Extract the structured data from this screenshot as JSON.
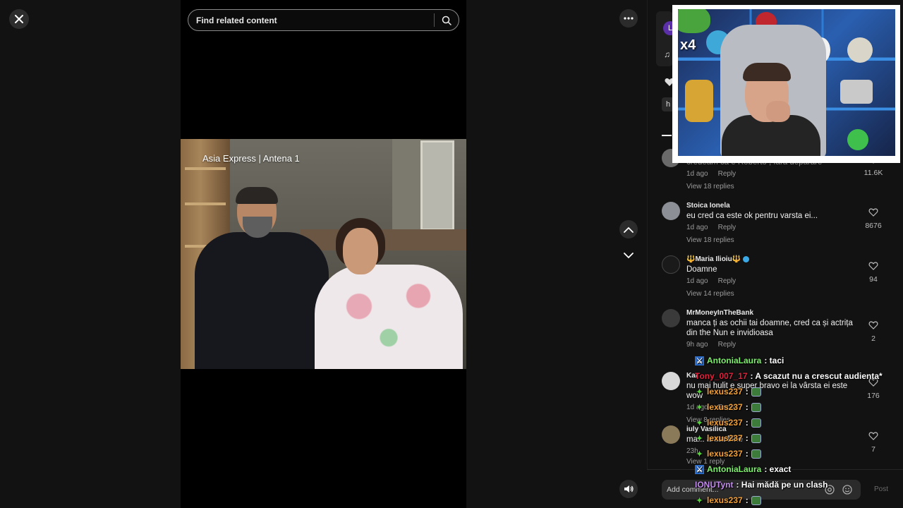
{
  "search": {
    "placeholder": "Find related content"
  },
  "video": {
    "watermark": "Asia Express | Antena 1"
  },
  "panel": {
    "avatar_letter": "L",
    "tag_letter": "h"
  },
  "comments": [
    {
      "user": "",
      "text": "credeam ca e Roberto , fara deparare",
      "time": "1d ago",
      "reply": "Reply",
      "view_replies": "View 18 replies",
      "likes": "11.6K"
    },
    {
      "user": "Stoica Ionela",
      "text": "eu cred ca este ok pentru varsta ei...",
      "time": "1d ago",
      "reply": "Reply",
      "view_replies": "View 18 replies",
      "likes": "8676"
    },
    {
      "user": "🔱Maria Ilioiu🔱",
      "text": "Doamne",
      "time": "1d ago",
      "reply": "Reply",
      "view_replies": "View 14 replies",
      "likes": "94"
    },
    {
      "user": "MrMoneyInTheBank",
      "text": "manca ți as ochii tai doamne, cred ca și actrița din the Nun e invidioasa",
      "time": "9h ago",
      "reply": "Reply",
      "view_replies": "",
      "likes": "2"
    },
    {
      "user": "Kar",
      "text": "nu mai hulit e super bravo ei la vârsta ei este wow",
      "time": "1d ago",
      "reply": "Reply",
      "view_replies": "View 8 replies",
      "likes": "176"
    },
    {
      "user": "iuly Vasilica",
      "text": "ma... arata bine",
      "time": "23h",
      "reply": "",
      "view_replies": "View 1 reply",
      "likes": "7"
    }
  ],
  "comment_bar": {
    "placeholder": "Add comment...",
    "post_label": "Post"
  },
  "webcam": {
    "multiplier": "x4"
  },
  "chat": [
    {
      "user": "AntoniaLaura",
      "color": "#7cf06a",
      "badge": "mod",
      "msg": ": taci"
    },
    {
      "user": "Tony_007_17",
      "color": "#e0223c",
      "badge": "none",
      "msg": ": A scazut nu a crescut audienta*"
    },
    {
      "user": "lexus237",
      "color": "#f0a03a",
      "badge": "sub",
      "msg": ":",
      "emote": true
    },
    {
      "user": "lexus237",
      "color": "#f0a03a",
      "badge": "sub",
      "msg": ":",
      "emote": true
    },
    {
      "user": "lexus237",
      "color": "#f0a03a",
      "badge": "sub",
      "msg": ":",
      "emote": true
    },
    {
      "user": "lexus237",
      "color": "#f0a03a",
      "badge": "sub",
      "msg": ":",
      "emote": true
    },
    {
      "user": "lexus237",
      "color": "#f0a03a",
      "badge": "sub",
      "msg": ":",
      "emote": true
    },
    {
      "user": "AntoniaLaura",
      "color": "#7cf06a",
      "badge": "mod",
      "msg": ": exact"
    },
    {
      "user": "IONUTynt",
      "color": "#c48cf0",
      "badge": "none",
      "msg": ": Hai mădă pe un clash"
    },
    {
      "user": "lexus237",
      "color": "#f0a03a",
      "badge": "sub",
      "msg": ":",
      "emote": true
    }
  ],
  "colors": {
    "background": "#121212",
    "video_bg": "#000000",
    "accent_text": "#ffffff",
    "muted_text": "#9a9a9a"
  }
}
